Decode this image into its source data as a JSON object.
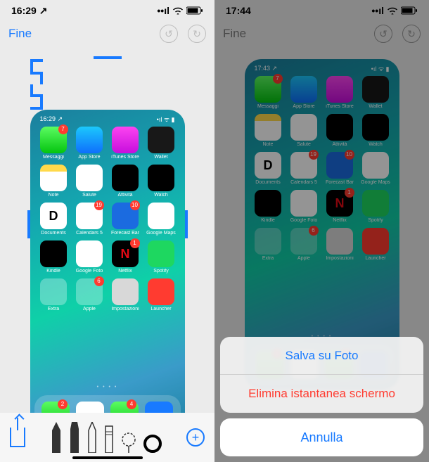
{
  "left": {
    "status": {
      "time": "16:29",
      "arrow": "↗"
    },
    "nav": {
      "done": "Fine"
    },
    "inner_status": {
      "time": "16:29",
      "arrow": "↗"
    },
    "apps_row1": [
      {
        "label": "Messaggi",
        "badge": "7"
      },
      {
        "label": "App Store",
        "badge": ""
      },
      {
        "label": "iTunes Store",
        "badge": ""
      },
      {
        "label": "Wallet",
        "badge": ""
      }
    ],
    "apps_row2": [
      {
        "label": "Note",
        "badge": ""
      },
      {
        "label": "Salute",
        "badge": ""
      },
      {
        "label": "Attività",
        "badge": ""
      },
      {
        "label": "Watch",
        "badge": ""
      }
    ],
    "apps_row3": [
      {
        "label": "Documents",
        "badge": ""
      },
      {
        "label": "Calendars 5",
        "badge": "19"
      },
      {
        "label": "Forecast Bar",
        "badge": "10"
      },
      {
        "label": "Google Maps",
        "badge": ""
      }
    ],
    "apps_row4": [
      {
        "label": "Kindle",
        "badge": ""
      },
      {
        "label": "Google Foto",
        "badge": ""
      },
      {
        "label": "Netflix",
        "badge": "1"
      },
      {
        "label": "Spotify",
        "badge": ""
      }
    ],
    "apps_row5": [
      {
        "label": "Extra",
        "badge": ""
      },
      {
        "label": "Apple",
        "badge": "6"
      },
      {
        "label": "Impostazioni",
        "badge": ""
      },
      {
        "label": "Launcher",
        "badge": ""
      }
    ],
    "dock": [
      {
        "label": "Phone",
        "badge": "2"
      },
      {
        "label": "Safari",
        "badge": ""
      },
      {
        "label": "WhatsApp",
        "badge": "4"
      },
      {
        "label": "Send",
        "badge": ""
      }
    ]
  },
  "right": {
    "status": {
      "time": "17:44"
    },
    "nav": {
      "done": "Fine"
    },
    "inner_status": {
      "time": "17:43",
      "arrow": "↗"
    },
    "sheet": {
      "save": "Salva su Foto",
      "delete": "Elimina istantanea schermo",
      "cancel": "Annulla"
    }
  }
}
